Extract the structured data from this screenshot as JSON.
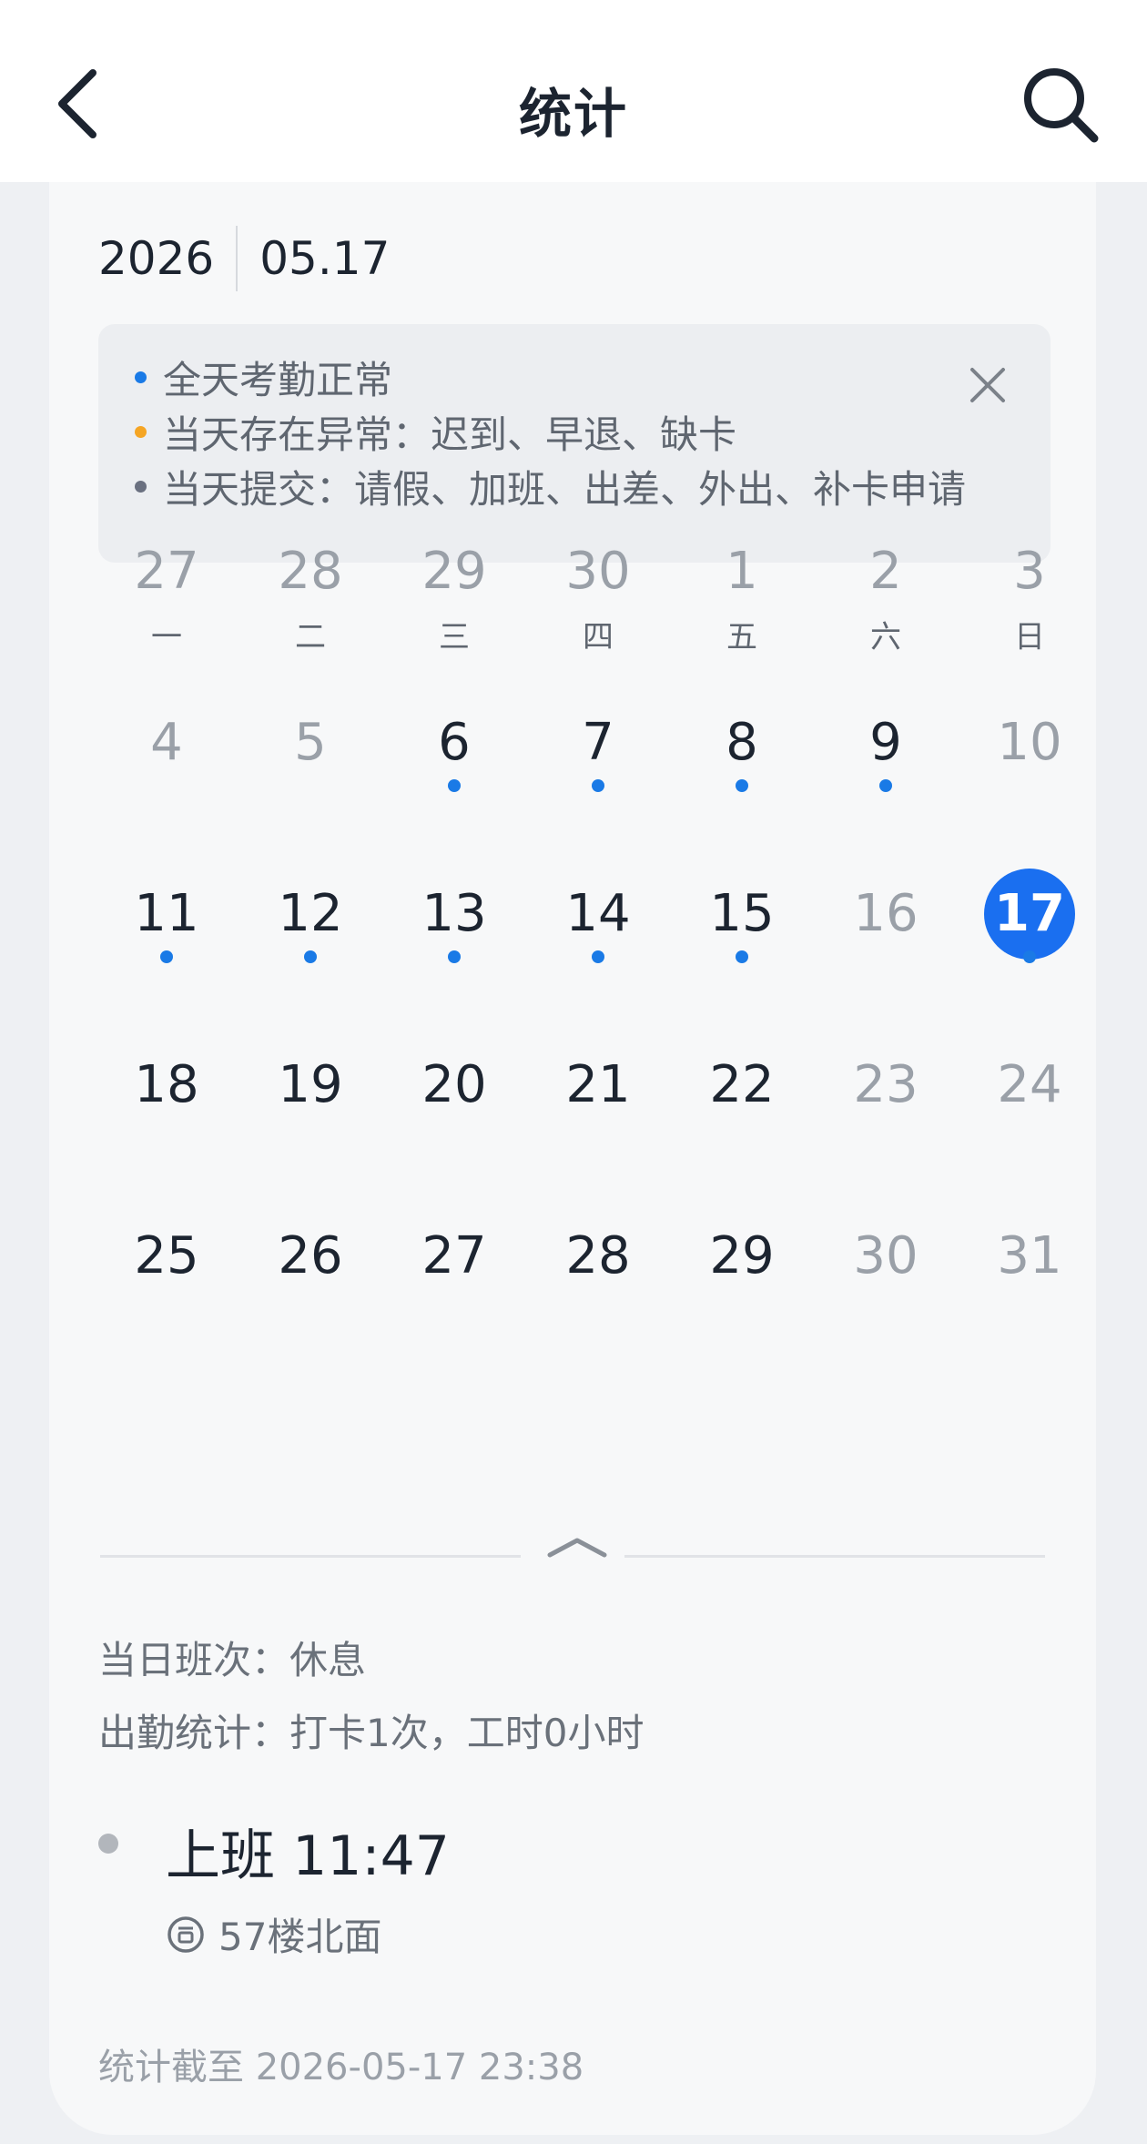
{
  "header": {
    "title": "统计"
  },
  "date": {
    "year": "2026",
    "month_day": "05.17"
  },
  "legend": {
    "items": [
      {
        "text": "全天考勤正常",
        "color": "#1a7ae6"
      },
      {
        "text": "当天存在异常：迟到、早退、缺卡",
        "color": "#f5a524"
      },
      {
        "text": "当天提交：请假、加班、出差、外出、补卡申请",
        "color": "#6a7080"
      }
    ]
  },
  "calendar": {
    "weekdays": [
      "一",
      "二",
      "三",
      "四",
      "五",
      "六",
      "日"
    ],
    "weeks": [
      [
        {
          "n": "27",
          "m": true
        },
        {
          "n": "28",
          "m": true
        },
        {
          "n": "29",
          "m": true
        },
        {
          "n": "30",
          "m": true
        },
        {
          "n": "1",
          "m": true
        },
        {
          "n": "2",
          "m": true
        },
        {
          "n": "3",
          "m": true
        }
      ],
      [
        {
          "n": "4",
          "m": true
        },
        {
          "n": "5",
          "m": true
        },
        {
          "n": "6",
          "dot": true
        },
        {
          "n": "7",
          "dot": true
        },
        {
          "n": "8",
          "dot": true
        },
        {
          "n": "9",
          "dot": true
        },
        {
          "n": "10",
          "m": true
        }
      ],
      [
        {
          "n": "11",
          "dot": true
        },
        {
          "n": "12",
          "dot": true
        },
        {
          "n": "13",
          "dot": true
        },
        {
          "n": "14",
          "dot": true
        },
        {
          "n": "15",
          "dot": true
        },
        {
          "n": "16",
          "m": true
        },
        {
          "n": "17",
          "dot": true,
          "sel": true
        }
      ],
      [
        {
          "n": "18"
        },
        {
          "n": "19"
        },
        {
          "n": "20"
        },
        {
          "n": "21"
        },
        {
          "n": "22"
        },
        {
          "n": "23",
          "m": true
        },
        {
          "n": "24",
          "m": true
        }
      ],
      [
        {
          "n": "25"
        },
        {
          "n": "26"
        },
        {
          "n": "27"
        },
        {
          "n": "28"
        },
        {
          "n": "29"
        },
        {
          "n": "30",
          "m": true
        },
        {
          "n": "31",
          "m": true
        }
      ]
    ]
  },
  "details": {
    "shift": "当日班次：休息",
    "attendance": "出勤统计：打卡1次，工时0小时",
    "record_title": "上班 11:47",
    "record_location": "57楼北面",
    "footer": "统计截至  2026-05-17 23:38"
  }
}
